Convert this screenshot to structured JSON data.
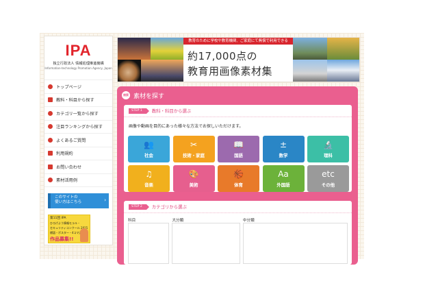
{
  "logo": {
    "mark": "IPA",
    "org_ja": "独立行政法人 情報処理推進機構",
    "org_en": "Information-technology Promotion Agency, Japan"
  },
  "nav": [
    {
      "label": "トップページ",
      "icon": "home-icon"
    },
    {
      "label": "教科・科目から探す",
      "icon": "book-icon"
    },
    {
      "label": "カテゴリ一覧から探す",
      "icon": "tag-icon"
    },
    {
      "label": "注目ランキングから探す",
      "icon": "trophy-icon"
    },
    {
      "label": "よくあるご質問",
      "icon": "question-icon"
    },
    {
      "label": "利用規約",
      "icon": "document-icon"
    },
    {
      "label": "お問い合わせ",
      "icon": "mail-icon"
    },
    {
      "label": "素材活用例",
      "icon": "pin-icon"
    }
  ],
  "help_banner": {
    "line1": "このサイトの",
    "line2": "使い方はこちら"
  },
  "contest": {
    "line1": "第11回 IPA",
    "line2": "ひろげよう情報モラル・",
    "line3": "セキュリティコンクール 2015",
    "line4": "標語・ポスター・4コマ漫画",
    "line5": "作品募集!!"
  },
  "banner": {
    "ribbon": "教育のために学校や教育機関、ご家庭にて無償で利用できる",
    "line1": "約17,000点の",
    "line2": "教育用画像素材集"
  },
  "main": {
    "badge": "検索",
    "title": "素材を探す",
    "step1": {
      "tag": "STEP 1",
      "title": "教科・科目から選ぶ",
      "desc": "画像や動画を目的にあった様々な方法でお探しいただけます。"
    },
    "step2": {
      "tag": "STEP 2",
      "title": "カテゴリから選ぶ",
      "col1": "科目",
      "col2": "大分類",
      "col3": "中分類"
    },
    "subjects": [
      {
        "label": "社会",
        "glyph": "👥",
        "color": "#3aa6d9",
        "icon": "people-icon"
      },
      {
        "label": "技術・家庭",
        "glyph": "✂",
        "color": "#f4a21f",
        "icon": "sewing-icon"
      },
      {
        "label": "国語",
        "glyph": "📖",
        "color": "#9c6aae",
        "icon": "book-icon"
      },
      {
        "label": "数学",
        "glyph": "±",
        "color": "#2a86c6",
        "icon": "calculator-icon"
      },
      {
        "label": "理科",
        "glyph": "🔬",
        "color": "#3cbfa6",
        "icon": "microscope-icon"
      },
      {
        "label": "音楽",
        "glyph": "♫",
        "color": "#f1b01d",
        "icon": "music-icon"
      },
      {
        "label": "美術",
        "glyph": "🎨",
        "color": "#e65f8e",
        "icon": "palette-icon"
      },
      {
        "label": "体育",
        "glyph": "🏀",
        "color": "#e87a2a",
        "icon": "ball-icon"
      },
      {
        "label": "外国語",
        "glyph": "Aa",
        "color": "#6cb23a",
        "icon": "language-icon"
      },
      {
        "label": "その他",
        "glyph": "etc",
        "color": "#9a9a9a",
        "icon": "etc-icon"
      }
    ]
  }
}
